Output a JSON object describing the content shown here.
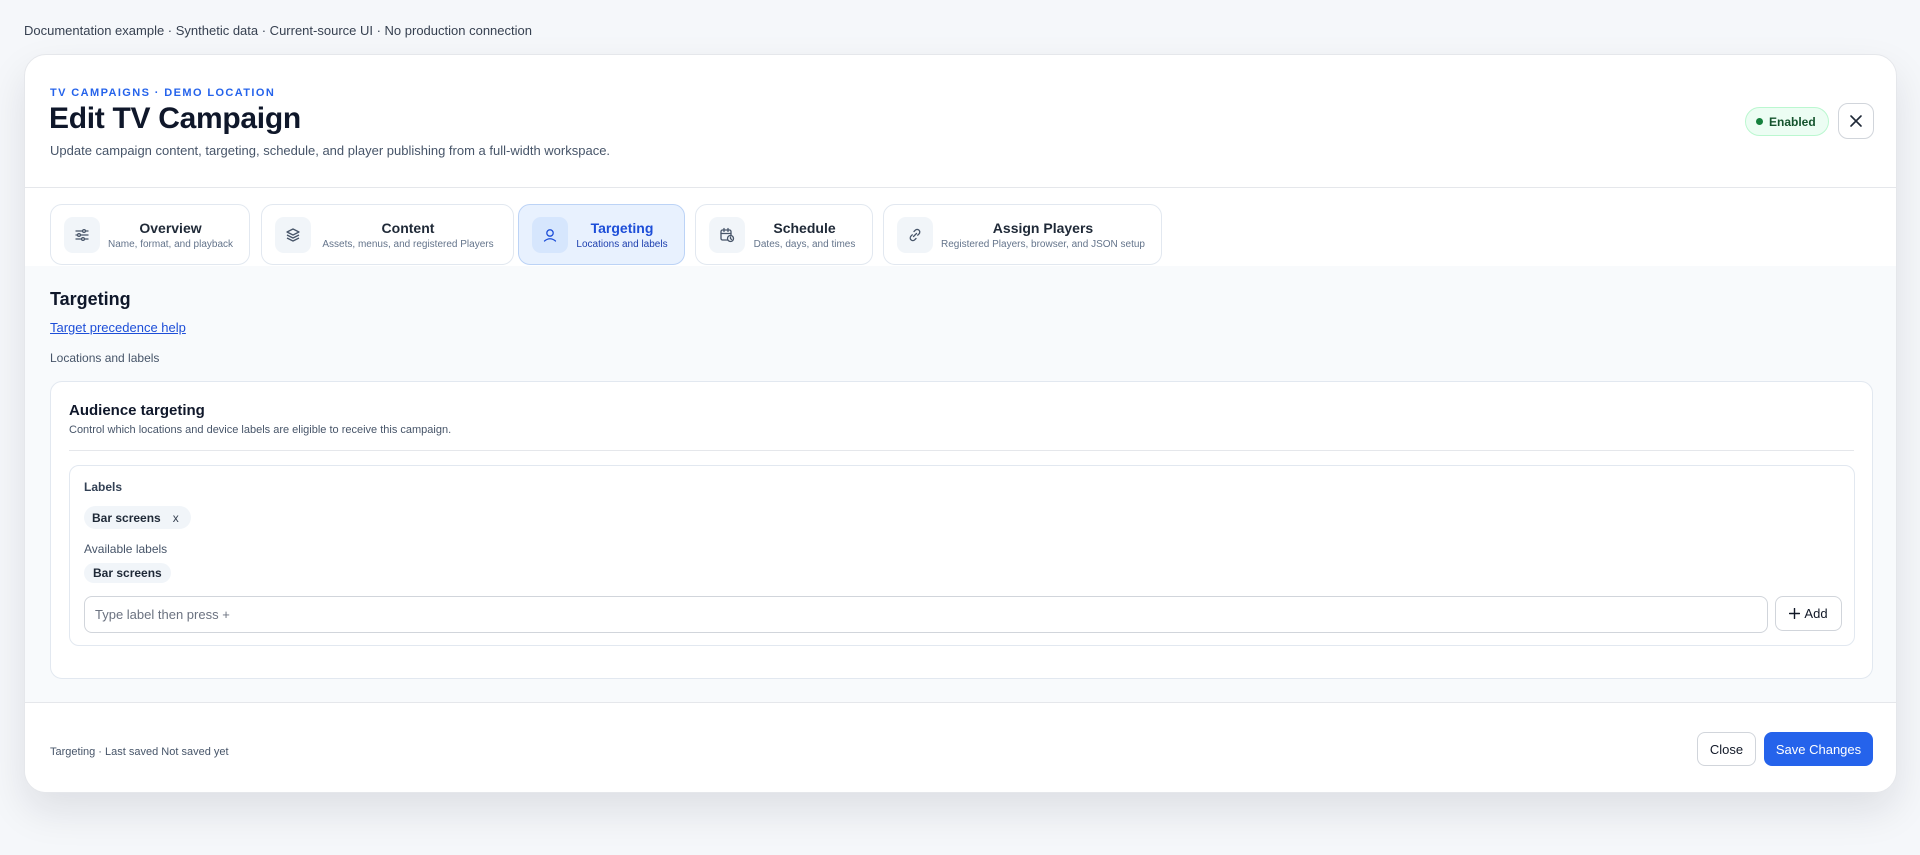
{
  "banner": "Documentation example · Synthetic data · Current-source UI · No production connection",
  "header": {
    "eyebrow": "TV CAMPAIGNS · DEMO LOCATION",
    "title": "Edit TV Campaign",
    "subtitle": "Update campaign content, targeting, schedule, and player publishing from a full-width workspace.",
    "status_badge": "Enabled",
    "status_color": "#15803d"
  },
  "tabs": [
    {
      "label": "Overview",
      "description": "Name, format, and playback",
      "icon": "sliders-icon",
      "active": false
    },
    {
      "label": "Content",
      "description": "Assets, menus, and registered Players",
      "icon": "layers-icon",
      "active": false
    },
    {
      "label": "Targeting",
      "description": "Locations and labels",
      "icon": "map-pin-user-icon",
      "active": true
    },
    {
      "label": "Schedule",
      "description": "Dates, days, and times",
      "icon": "calendar-clock-icon",
      "active": false
    },
    {
      "label": "Assign Players",
      "description": "Registered Players, browser, and JSON setup",
      "icon": "link-icon",
      "active": false
    }
  ],
  "section": {
    "title": "Targeting",
    "help_link": "Target precedence help",
    "caption": "Locations and labels"
  },
  "card": {
    "title": "Audience targeting",
    "description": "Control which locations and device labels are eligible to receive this campaign.",
    "labels_title": "Labels",
    "selected_labels": [
      "Bar screens"
    ],
    "remove_glyph": "x",
    "available_title": "Available labels",
    "available_labels": [
      "Bar screens"
    ],
    "input_placeholder": "Type label then press +",
    "input_value": "",
    "add_label": "Add"
  },
  "footer": {
    "status": "Targeting · Last saved Not saved yet",
    "close_label": "Close",
    "save_label": "Save Changes"
  },
  "colors": {
    "accent": "#2563eb",
    "active_tab_bg": "#e8f1fe"
  }
}
